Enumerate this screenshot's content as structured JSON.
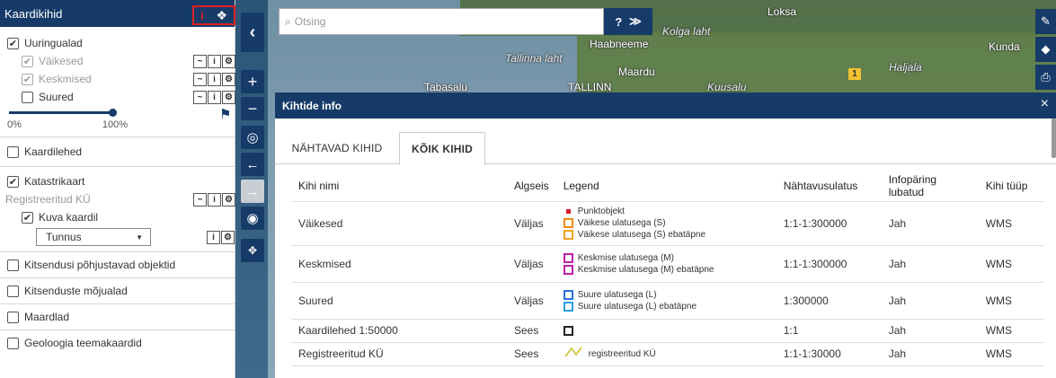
{
  "left_panel": {
    "title": "Kaardikihid",
    "info_icon": "i",
    "groups": {
      "uuringualad": {
        "label": "Uuringualad",
        "checked": true,
        "children": [
          {
            "label": "Väikesed",
            "checked": true,
            "dimmed": true
          },
          {
            "label": "Keskmised",
            "checked": true,
            "dimmed": true
          },
          {
            "label": "Suured",
            "checked": false,
            "dimmed": false
          }
        ],
        "opacity_min": "0%",
        "opacity_max": "100%",
        "opacity_value": 1.0
      },
      "kaardilehed": {
        "label": "Kaardilehed",
        "checked": false
      },
      "katastrikaart": {
        "label": "Katastrikaart",
        "checked": true,
        "child_label": "Registreeritud KÜ",
        "kuva_kaardil": "Kuva kaardil",
        "select_value": "Tunnus"
      },
      "kitsendusi": {
        "label": "Kitsendusi põhjustavad objektid",
        "checked": false
      },
      "mojualad": {
        "label": "Kitsenduste mõjualad",
        "checked": false
      },
      "maardlad": {
        "label": "Maardlad",
        "checked": false
      },
      "geoloogia": {
        "label": "Geoloogia teemakaardid",
        "checked": false
      }
    }
  },
  "search": {
    "placeholder": "Otsing",
    "help": "?",
    "expand": "≫"
  },
  "map_labels": {
    "loksa": "Loksa",
    "kolga": "Kolga laht",
    "haabneeme": "Haabneeme",
    "tallinna_laht": "Tallinna laht",
    "maardu": "Maardu",
    "tallinn": "TALLINN",
    "kuusalu": "Kuusalu",
    "tabasalu": "Tabasalu",
    "kunda": "Kunda",
    "haljala": "Haljala",
    "road": "1"
  },
  "dialog": {
    "title": "Kihtide info",
    "close": "×",
    "tabs": [
      "NÄHTAVAD KIHID",
      "KÕIK KIHID"
    ],
    "active_tab": 1,
    "columns": [
      "Kihi nimi",
      "Algseis",
      "Legend",
      "Nähtavusulatus",
      "Infopäring lubatud",
      "Kihi tüüp"
    ],
    "rows": [
      {
        "name": "Väikesed",
        "state": "Väljas",
        "legend": [
          {
            "kind": "dot",
            "color": "#d11a2a",
            "text": "Punktobjekt"
          },
          {
            "kind": "box",
            "color": "#f08c1a",
            "text": "Väikese ulatusega (S)"
          },
          {
            "kind": "dash",
            "color": "#f0a020",
            "text": "Väikese ulatusega (S) ebatäpne"
          }
        ],
        "scale": "1:1-1:300000",
        "info": "Jah",
        "type": "WMS"
      },
      {
        "name": "Keskmised",
        "state": "Väljas",
        "legend": [
          {
            "kind": "box",
            "color": "#c21fa8",
            "text": "Keskmise ulatusega (M)"
          },
          {
            "kind": "dash",
            "color": "#c21fa8",
            "text": "Keskmise ulatusega (M) ebatäpne"
          }
        ],
        "scale": "1:1-1:300000",
        "info": "Jah",
        "type": "WMS"
      },
      {
        "name": "Suured",
        "state": "Väljas",
        "legend": [
          {
            "kind": "box",
            "color": "#2a6fe0",
            "text": "Suure ulatusega (L)"
          },
          {
            "kind": "dash",
            "color": "#2a9fe0",
            "text": "Suure ulatusega (L) ebatäpne"
          }
        ],
        "scale": "1:300000",
        "info": "Jah",
        "type": "WMS"
      },
      {
        "name": "Kaardilehed 1:50000",
        "state": "Sees",
        "legend": [
          {
            "kind": "box",
            "color": "#222222",
            "text": ""
          }
        ],
        "scale": "1:1",
        "info": "Jah",
        "type": "WMS"
      },
      {
        "name": "Registreeritud KÜ",
        "state": "Sees",
        "legend": [
          {
            "kind": "line",
            "color": "#c8c020",
            "text": "registreeritud KÜ"
          }
        ],
        "scale": "1:1-1:30000",
        "info": "Jah",
        "type": "WMS"
      }
    ]
  }
}
